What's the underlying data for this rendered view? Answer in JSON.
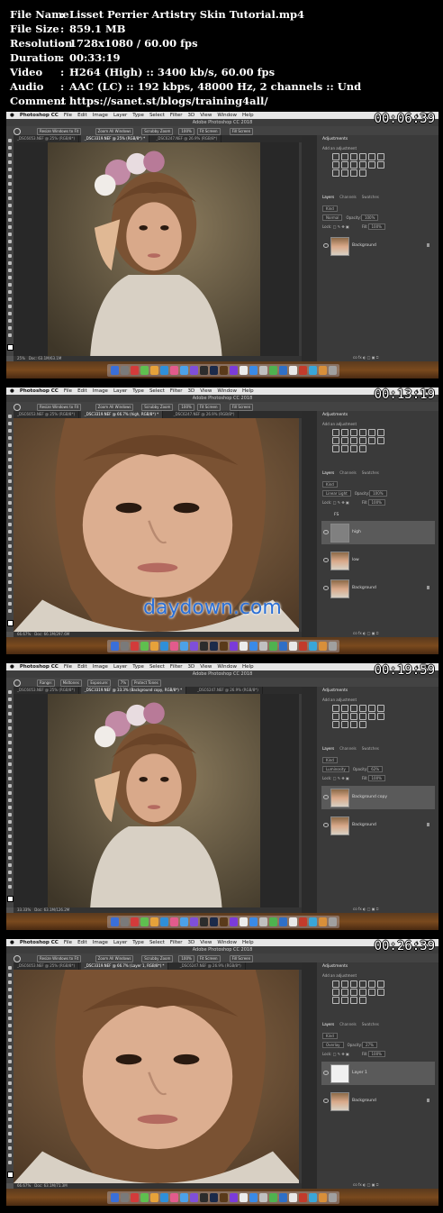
{
  "file_info": {
    "rows": [
      {
        "label": "File Name",
        "value": "Lisset Perrier Artistry  Skin Tutorial.mp4"
      },
      {
        "label": "File Size",
        "value": "859.1 MB"
      },
      {
        "label": "Resolution",
        "value": "1728x1080 / 60.00 fps"
      },
      {
        "label": "Duration",
        "value": "00:33:19"
      },
      {
        "label": "Video",
        "value": "H264 (High) :: 3400 kb/s, 60.00 fps"
      },
      {
        "label": "Audio",
        "value": "AAC (LC) :: 192 kbps, 48000 Hz, 2 channels :: Und"
      },
      {
        "label": "Comment",
        "value": "https://sanet.st/blogs/training4all/"
      }
    ]
  },
  "menu": {
    "app": "Photoshop CC",
    "items": [
      "File",
      "Edit",
      "Image",
      "Layer",
      "Type",
      "Select",
      "Filter",
      "3D",
      "View",
      "Window",
      "Help"
    ]
  },
  "panel_labels": {
    "adjustments": "Adjustments",
    "add_adjustment": "Add an adjustment",
    "layers": "Layers",
    "channels": "Channels",
    "swatches": "Swatches",
    "opacity": "Opacity:",
    "fill": "Fill:",
    "lock": "Lock:",
    "kind": "Kind"
  },
  "frames": [
    {
      "timestamp": "00:06:39",
      "window_title": "Adobe Photoshop CC 2018",
      "opt_buttons": [
        "Resize Windows to Fit",
        "Zoom All Windows",
        "Scrubby Zoom",
        "100%",
        "Fit Screen",
        "Fill Screen"
      ],
      "tabs": [
        "_DSC6053.NEF @ 25% (RGB/8*)",
        "_DSC3319.NEF @ 25% (RGB/8*) *",
        "_DSC6247.NEF @ 26.9% (RGB/8*)"
      ],
      "active_tab": 1,
      "status_zoom": "25%",
      "status_doc": "Doc: 63.1M/63.1M",
      "blend": "Normal",
      "opacity": "100%",
      "fill": "100%",
      "layers": [
        {
          "name": "Background",
          "thumb": "photo",
          "selected": false,
          "locked": true
        }
      ],
      "photo_view": "wide"
    },
    {
      "timestamp": "00:13:19",
      "window_title": "Adobe Photoshop CC 2018",
      "opt_buttons": [
        "Resize Windows to Fit",
        "Zoom All Windows",
        "Scrubby Zoom",
        "100%",
        "Fit Screen",
        "Fill Screen"
      ],
      "tabs": [
        "_DSC6053.NEF @ 25% (RGB/8*)",
        "_DSC3319.NEF @ 66.7% (high, RGB/8*) *",
        "_DSC6247.NEF @ 26.9% (RGB/8*)"
      ],
      "active_tab": 1,
      "status_zoom": "66.67%",
      "status_doc": "Doc: 66.1M/297.6M",
      "blend": "Linear Light",
      "opacity": "100%",
      "fill": "100%",
      "group_name": "FS",
      "layers": [
        {
          "name": "high",
          "thumb": "gray",
          "selected": true,
          "locked": false
        },
        {
          "name": "low",
          "thumb": "photo",
          "selected": false,
          "locked": false
        },
        {
          "name": "Background",
          "thumb": "photo",
          "selected": false,
          "locked": true
        }
      ],
      "photo_view": "close",
      "watermark": "daydown.com"
    },
    {
      "timestamp": "00:19:59",
      "window_title": "Adobe Photoshop CC 2018",
      "opt_buttons": [
        "Range:",
        "Midtones",
        "Exposure:",
        "7%",
        "Protect Tones"
      ],
      "tabs": [
        "_DSC6053.NEF @ 25% (RGB/8*)",
        "_DSC3319.NEF @ 33.3% (Background copy, RGB/8*) *",
        "_DSC6247.NEF @ 26.9% (RGB/8*)"
      ],
      "active_tab": 1,
      "status_zoom": "33.33%",
      "status_doc": "Doc: 63.1M/126.2M",
      "blend": "Luminosity",
      "opacity": "62%",
      "fill": "100%",
      "layers": [
        {
          "name": "Background copy",
          "thumb": "photo",
          "selected": true,
          "locked": false
        },
        {
          "name": "Background",
          "thumb": "photo",
          "selected": false,
          "locked": true
        }
      ],
      "photo_view": "wide"
    },
    {
      "timestamp": "00:26:39",
      "window_title": "Adobe Photoshop CC 2018",
      "opt_buttons": [
        "Resize Windows to Fit",
        "Zoom All Windows",
        "Scrubby Zoom",
        "100%",
        "Fit Screen",
        "Fill Screen"
      ],
      "tabs": [
        "_DSC6053.NEF @ 25% (RGB/8*)",
        "_DSC3319.NEF @ 66.7% (Layer 1, RGB/8*) *",
        "_DSC6247.NEF @ 26.9% (RGB/8*)"
      ],
      "active_tab": 1,
      "status_zoom": "66.67%",
      "status_doc": "Doc: 63.1M/71.3M",
      "blend": "Overlay",
      "opacity": "27%",
      "fill": "100%",
      "layers": [
        {
          "name": "Layer 1",
          "thumb": "white",
          "selected": true,
          "locked": false
        },
        {
          "name": "Background",
          "thumb": "photo",
          "selected": false,
          "locked": true
        }
      ],
      "photo_view": "close"
    }
  ],
  "colors": {
    "ps_gray": "#535353",
    "panel": "#3a3a3a",
    "timestamp": "#ffffff",
    "watermark": "#2a6fd6"
  }
}
